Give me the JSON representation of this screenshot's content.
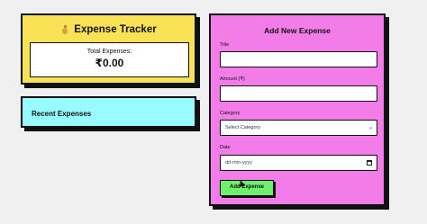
{
  "tracker": {
    "title": "Expense Tracker",
    "icon": "money-bag-icon",
    "total_label": "Total Expenses:",
    "total_value": "₹0.00"
  },
  "recent": {
    "title": "Recent Expenses"
  },
  "form": {
    "title": "Add New Expense",
    "title_label": "Title",
    "title_value": "",
    "amount_label": "Amount (₹)",
    "amount_value": "",
    "category_label": "Category",
    "category_selected": "Select Category",
    "date_label": "Date",
    "date_placeholder": "dd-mm-yyyy",
    "submit_label": "Add Expense"
  },
  "colors": {
    "tracker_bg": "#f9e256",
    "recent_bg": "#98fbff",
    "form_bg": "#f27ce8",
    "button_bg": "#6ef06e"
  }
}
